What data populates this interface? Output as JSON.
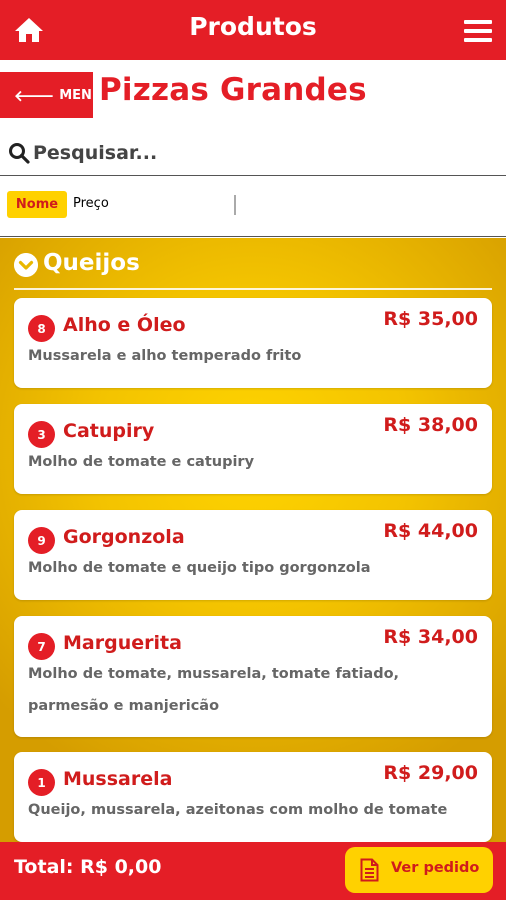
{
  "header": {
    "title": "Produtos",
    "home_icon": "home-icon",
    "menu_icon": "hamburger-menu-icon"
  },
  "nav": {
    "menu_label": "MENU",
    "back_icon": "arrow-left-icon",
    "page_title": "Pizzas Grandes"
  },
  "search": {
    "placeholder": "Pesquisar...",
    "icon": "search-icon"
  },
  "sort": {
    "options": [
      "Nome",
      "Preço"
    ],
    "selected": "Nome"
  },
  "category": {
    "name": "Queijos",
    "icon": "chevron-down-circle-icon"
  },
  "products": [
    {
      "number": "8",
      "name": "Alho e Óleo",
      "price": "R$ 35,00",
      "description": "Mussarela e alho temperado frito"
    },
    {
      "number": "3",
      "name": "Catupiry",
      "price": "R$ 38,00",
      "description": "Molho de tomate e catupiry"
    },
    {
      "number": "9",
      "name": "Gorgonzola",
      "price": "R$ 44,00",
      "description": "Molho de tomate e queijo tipo gorgonzola"
    },
    {
      "number": "7",
      "name": "Marguerita",
      "price": "R$ 34,00",
      "description": "Molho de tomate, mussarela, tomate fatiado, parmesão e manjericão"
    },
    {
      "number": "1",
      "name": "Mussarela",
      "price": "R$ 29,00",
      "description": "Queijo, mussarela, azeitonas com molho de tomate"
    }
  ],
  "footer": {
    "total": "Total: R$ 0,00",
    "order_button": "Ver pedido",
    "order_icon": "document-icon"
  },
  "colors": {
    "primary_red": "#e41e26",
    "accent_yellow": "#ffd100",
    "text_red": "#d01c1c"
  }
}
